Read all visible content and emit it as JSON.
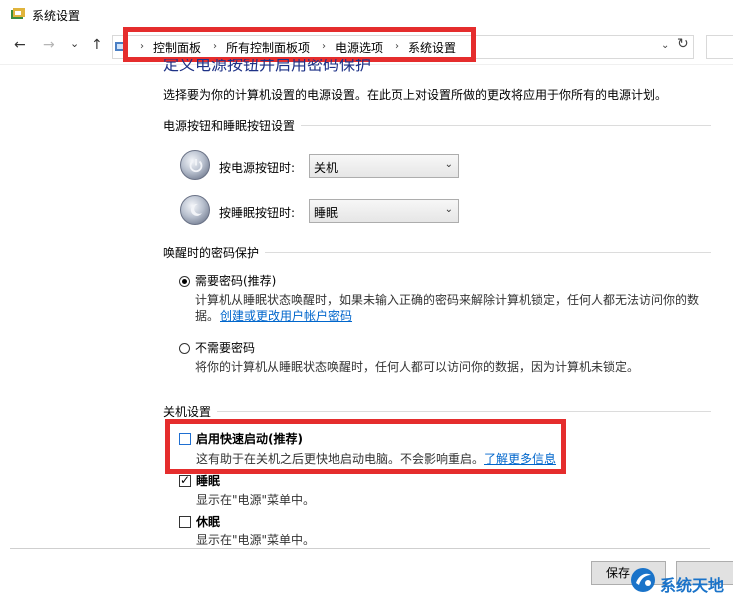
{
  "window": {
    "title": "系统设置"
  },
  "nav": {
    "back": "←",
    "forward": "→",
    "recent": "⌄",
    "up": "↑",
    "breadcrumbs": [
      "控制面板",
      "所有控制面板项",
      "电源选项",
      "系统设置"
    ],
    "separator": "›",
    "dropdown": "⌄",
    "refresh": "↻"
  },
  "page": {
    "heading": "定义电源按钮并启用密码保护",
    "description": "选择要为你的计算机设置的电源设置。在此页上对设置所做的更改将应用于你所有的电源计划。"
  },
  "power_buttons": {
    "group_label": "电源按钮和睡眠按钮设置",
    "power": {
      "label": "按电源按钮时:",
      "value": "关机"
    },
    "sleep": {
      "label": "按睡眠按钮时:",
      "value": "睡眠"
    },
    "arrow": "⌄"
  },
  "password": {
    "group_label": "唤醒时的密码保护",
    "require": {
      "label": "需要密码(推荐)",
      "desc_line1": "计算机从睡眠状态唤醒时，如果未输入正确的密码来解除计算机锁定，任何人都无法访问你的数",
      "desc_line2": "据。",
      "link": "创建或更改用户帐户密码",
      "checked": true
    },
    "not_require": {
      "label": "不需要密码",
      "desc": "将你的计算机从睡眠状态唤醒时，任何人都可以访问你的数据，因为计算机未锁定。",
      "checked": false
    }
  },
  "shutdown": {
    "group_label": "关机设置",
    "fast_startup": {
      "label": "启用快速启动(推荐)",
      "desc": "这有助于在关机之后更快地启动电脑。不会影响重启。",
      "link": "了解更多信息",
      "checked": false
    },
    "sleep": {
      "label": "睡眠",
      "desc": "显示在\"电源\"菜单中。",
      "checked": true
    },
    "hibernate": {
      "label": "休眠",
      "desc": "显示在\"电源\"菜单中。",
      "checked": false
    },
    "tick": "✓"
  },
  "footer": {
    "save": "保存"
  },
  "watermark": {
    "text": "系统天地"
  },
  "colors": {
    "highlight": "#e52d2d",
    "link": "#0066cc",
    "heading": "#1e3287"
  }
}
